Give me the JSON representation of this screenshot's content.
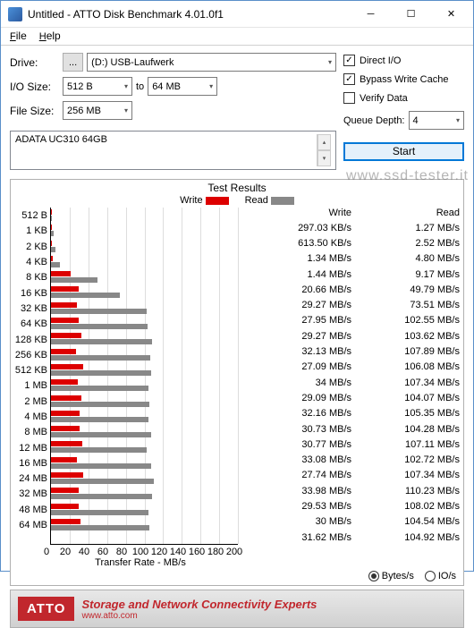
{
  "window": {
    "title": "Untitled - ATTO Disk Benchmark 4.01.0f1"
  },
  "menu": {
    "file": "File",
    "help": "Help"
  },
  "form": {
    "drive_lbl": "Drive:",
    "drive_btn": "...",
    "drive_val": "(D:) USB-Laufwerk",
    "io_lbl": "I/O Size:",
    "io_from": "512 B",
    "io_to_lbl": "to",
    "io_to": "64 MB",
    "fs_lbl": "File Size:",
    "fs_val": "256 MB",
    "device": "ADATA UC310 64GB"
  },
  "opts": {
    "direct_io": "Direct I/O",
    "bypass": "Bypass Write Cache",
    "verify": "Verify Data",
    "qd_lbl": "Queue Depth:",
    "qd_val": "4",
    "start": "Start"
  },
  "results": {
    "title": "Test Results",
    "write_lbl": "Write",
    "read_lbl": "Read",
    "xlabel": "Transfer Rate - MB/s",
    "col_write": "Write",
    "col_read": "Read",
    "bytes": "Bytes/s",
    "ios": "IO/s"
  },
  "chart_data": {
    "type": "bar",
    "xlabel": "Transfer Rate - MB/s",
    "xlim": [
      0,
      200
    ],
    "xticks": [
      0,
      20,
      40,
      60,
      80,
      100,
      120,
      140,
      160,
      180,
      200
    ],
    "categories": [
      "512 B",
      "1 KB",
      "2 KB",
      "4 KB",
      "8 KB",
      "16 KB",
      "32 KB",
      "64 KB",
      "128 KB",
      "256 KB",
      "512 KB",
      "1 MB",
      "2 MB",
      "4 MB",
      "8 MB",
      "12 MB",
      "16 MB",
      "24 MB",
      "32 MB",
      "48 MB",
      "64 MB"
    ],
    "series": [
      {
        "name": "Write",
        "color": "#d00",
        "values_label": [
          "297.03 KB/s",
          "613.50 KB/s",
          "1.34 MB/s",
          "1.44 MB/s",
          "20.66 MB/s",
          "29.27 MB/s",
          "27.95 MB/s",
          "29.27 MB/s",
          "32.13 MB/s",
          "27.09 MB/s",
          "34 MB/s",
          "29.09 MB/s",
          "32.16 MB/s",
          "30.73 MB/s",
          "30.77 MB/s",
          "33.08 MB/s",
          "27.74 MB/s",
          "33.98 MB/s",
          "29.53 MB/s",
          "30 MB/s",
          "31.62 MB/s"
        ],
        "values_mb": [
          0.3,
          0.61,
          1.34,
          1.44,
          20.66,
          29.27,
          27.95,
          29.27,
          32.13,
          27.09,
          34,
          29.09,
          32.16,
          30.73,
          30.77,
          33.08,
          27.74,
          33.98,
          29.53,
          30,
          31.62
        ]
      },
      {
        "name": "Read",
        "color": "#888",
        "values_label": [
          "1.27 MB/s",
          "2.52 MB/s",
          "4.80 MB/s",
          "9.17 MB/s",
          "49.79 MB/s",
          "73.51 MB/s",
          "102.55 MB/s",
          "103.62 MB/s",
          "107.89 MB/s",
          "106.08 MB/s",
          "107.34 MB/s",
          "104.07 MB/s",
          "105.35 MB/s",
          "104.28 MB/s",
          "107.11 MB/s",
          "102.72 MB/s",
          "107.34 MB/s",
          "110.23 MB/s",
          "108.02 MB/s",
          "104.54 MB/s",
          "104.92 MB/s"
        ],
        "values_mb": [
          1.27,
          2.52,
          4.8,
          9.17,
          49.79,
          73.51,
          102.55,
          103.62,
          107.89,
          106.08,
          107.34,
          104.07,
          105.35,
          104.28,
          107.11,
          102.72,
          107.34,
          110.23,
          108.02,
          104.54,
          104.92
        ]
      }
    ]
  },
  "footer": {
    "logo": "ATTO",
    "tag1": "Storage and Network Connectivity Experts",
    "tag2": "www.atto.com"
  },
  "watermark": "www.ssd-tester.it"
}
